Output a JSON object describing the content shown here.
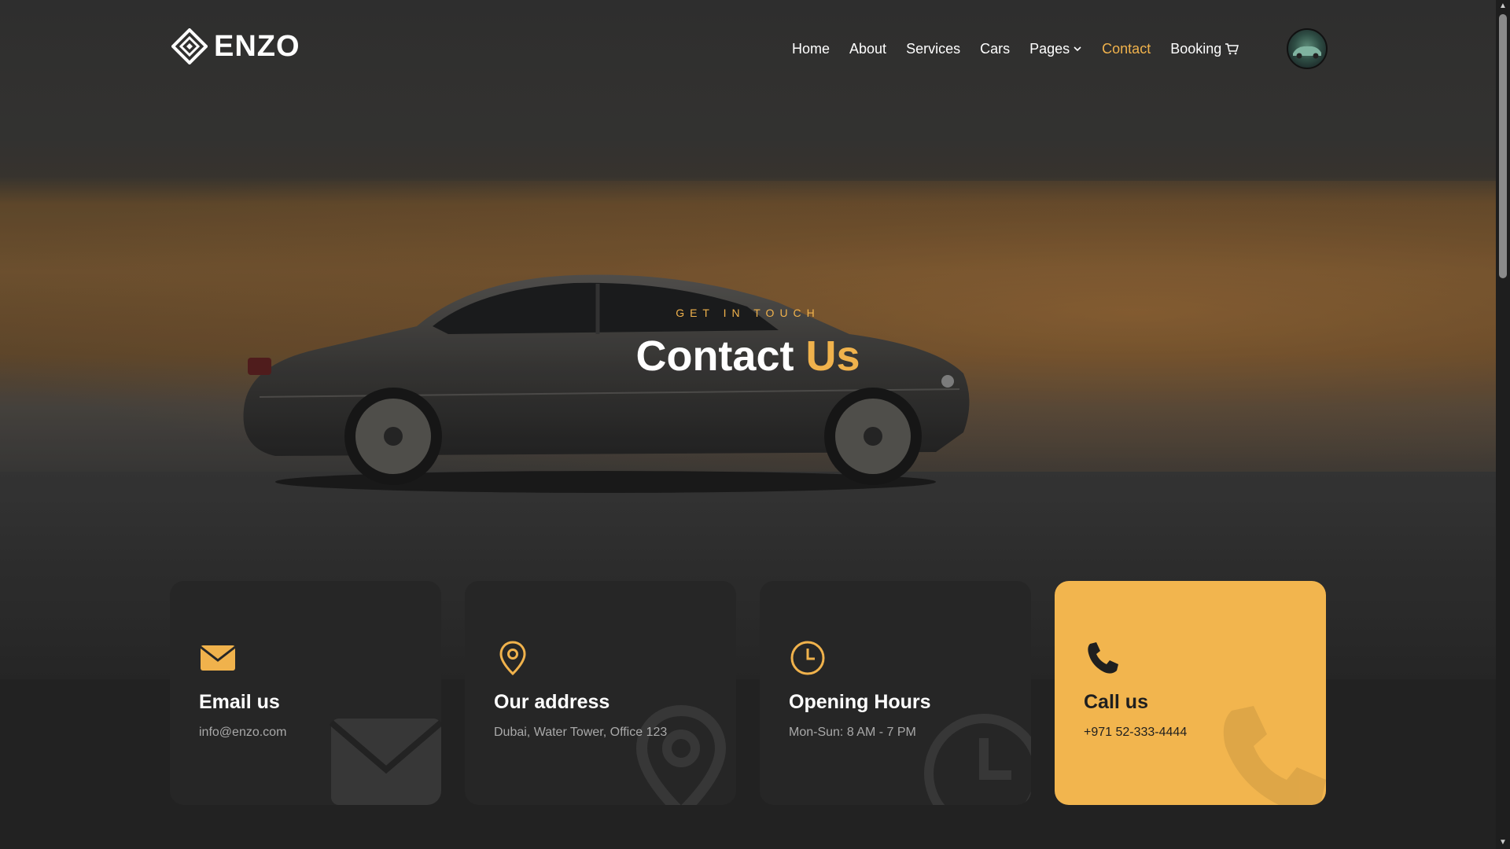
{
  "brand": {
    "name": "ENZO"
  },
  "nav": {
    "items": [
      {
        "label": "Home",
        "active": false
      },
      {
        "label": "About",
        "active": false
      },
      {
        "label": "Services",
        "active": false
      },
      {
        "label": "Cars",
        "active": false
      },
      {
        "label": "Pages",
        "active": false,
        "dropdown": true
      },
      {
        "label": "Contact",
        "active": true
      },
      {
        "label": "Booking",
        "active": false,
        "icon": "cart-icon"
      }
    ]
  },
  "hero": {
    "subtitle": "GET IN TOUCH",
    "title_main": "Contact",
    "title_accent": "Us"
  },
  "cards": [
    {
      "icon": "envelope-icon",
      "title": "Email us",
      "value": "info@enzo.com",
      "highlight": false
    },
    {
      "icon": "location-pin-icon",
      "title": "Our address",
      "value": "Dubai, Water Tower, Office 123",
      "highlight": false
    },
    {
      "icon": "clock-icon",
      "title": "Opening Hours",
      "value": "Mon-Sun: 8 AM - 7 PM",
      "highlight": false
    },
    {
      "icon": "phone-icon",
      "title": "Call us",
      "value": "+971 52-333-4444",
      "highlight": true
    }
  ],
  "colors": {
    "accent": "#f0b24c",
    "card_bg": "#262626",
    "highlight_card_bg": "#f2b54e",
    "page_bg": "#222222"
  }
}
